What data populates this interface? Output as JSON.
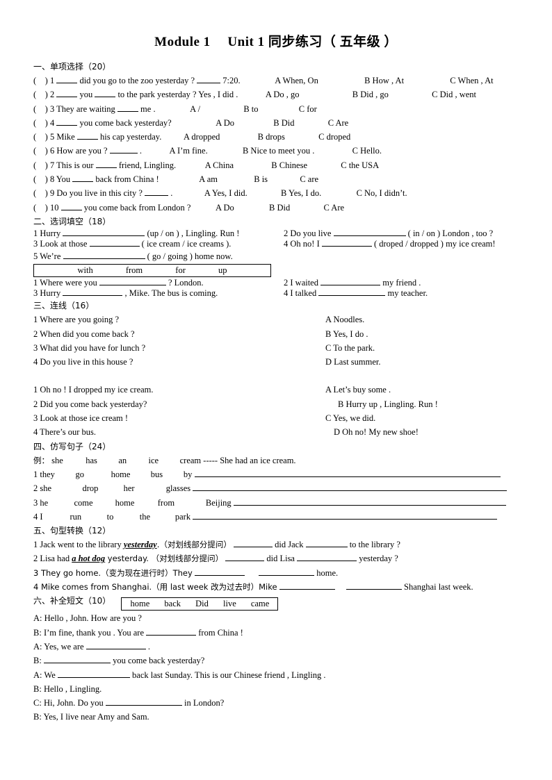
{
  "doc": {
    "title": "Module 1　 Unit 1 同步练习（ 五年级 ）"
  },
  "section1": {
    "heading": "一、单项选择（20）",
    "items": [
      {
        "num": "1",
        "stem_a": "did you go to the zoo yesterday ?",
        "stem_b": "7:20.",
        "a": "A When, On",
        "b": "B How , At",
        "c": "C When , At"
      },
      {
        "num": "2",
        "stem_a": "you",
        "stem_b": "to the park yesterday ? Yes , I did .",
        "a": "A Do , go",
        "b": "B Did , go",
        "c": "C Did , went"
      },
      {
        "num": "3",
        "stem_a": "They are waiting",
        "stem_b": "me .",
        "a": "A /",
        "b": "B to",
        "c": "C for"
      },
      {
        "num": "4",
        "stem_a": "",
        "stem_b": "you come back yesterday?",
        "a": "A Do",
        "b": "B Did",
        "c": "C Are"
      },
      {
        "num": "5",
        "stem_a": "Mike",
        "stem_b": "his cap yesterday.",
        "a": "A dropped",
        "b": "B drops",
        "c": "C droped"
      },
      {
        "num": "6",
        "stem_a": "How are you ?",
        "stem_b": ".",
        "a": "A I’m fine.",
        "b": "B Nice to meet you .",
        "c": "C Hello."
      },
      {
        "num": "7",
        "stem_a": "This is our",
        "stem_b": "friend, Lingling.",
        "a": "A China",
        "b": "B Chinese",
        "c": "C the USA"
      },
      {
        "num": "8",
        "stem_a": "You",
        "stem_b": "back from China !",
        "a": "A am",
        "b": "B is",
        "c": "C are"
      },
      {
        "num": "9",
        "stem_a": "Do you live in this city ?",
        "stem_b": ".",
        "a": "A Yes, I did.",
        "b": "B Yes, I do.",
        "c": "C No, I didn’t."
      },
      {
        "num": "10",
        "stem_a": "",
        "stem_b": "you come back from London ?",
        "a": "A Do",
        "b": "B Did",
        "c": "C Are"
      }
    ]
  },
  "section2": {
    "heading": "二、选词填空（18）",
    "q1_pre": "1 Hurry",
    "q1_post": "(up / on ) , Lingling. Run !",
    "q2_pre": "2 Do you live",
    "q2_post": "( in / on ) London , too ?",
    "q3_pre": "3 Look at those",
    "q3_post": "( ice cream / ice creams ).",
    "q4_pre": "4 Oh no! I",
    "q4_post": "( droped / dropped ) my ice cream!",
    "q5_pre": "5 We’re",
    "q5_post": "( go / going ) home now.",
    "wordbank": [
      "with",
      "from",
      "for",
      "up"
    ],
    "b1_pre": "1 Where were you",
    "b1_post": "? London.",
    "b2_pre": "2 I waited",
    "b2_post": "my friend .",
    "b3_pre": "3 Hurry",
    "b3_post": ", Mike. The bus is coming.",
    "b4_pre": "4 I talked",
    "b4_post": "my teacher."
  },
  "section3": {
    "heading": "三、连线（16）",
    "group1": {
      "questions": [
        "1 Where are you going ?",
        "2 When did you come back ?",
        "3 What did you have for lunch ?",
        "4 Do you live in this house ?"
      ],
      "answers": [
        "A Noodles.",
        "B Yes, I do .",
        "C To the park.",
        "D Last summer."
      ]
    },
    "group2": {
      "questions": [
        "1 Oh no ! I dropped my ice cream.",
        "2 Did you come back yesterday?",
        "3 Look at those ice cream !",
        "4 There’s our bus."
      ],
      "answers": [
        "A Let’s buy some .",
        "B Hurry up , Lingling. Run !",
        "C Yes, we did.",
        "D Oh no! My new shoe!"
      ]
    }
  },
  "section4": {
    "heading": "四、仿写句子（24）",
    "example_label": "例：",
    "example_words": [
      "she",
      "has",
      "an",
      "ice",
      "cream"
    ],
    "example_sep": "-----",
    "example_answer": "She had an ice cream.",
    "items": [
      {
        "num": "1",
        "words": [
          "they",
          "go",
          "home",
          "bus",
          "by"
        ]
      },
      {
        "num": "2",
        "words": [
          "she",
          "drop",
          "her",
          "glasses"
        ]
      },
      {
        "num": "3",
        "words": [
          "he",
          "come",
          "home",
          "from",
          "Beijing"
        ]
      },
      {
        "num": "4",
        "words": [
          "I",
          "run",
          "to",
          "the",
          "park"
        ]
      }
    ]
  },
  "section5": {
    "heading": "五、句型转换（12）",
    "q1_a": "1 Jack went to the library ",
    "q1_em": "yesterday",
    "q1_b": ".（对划线部分提问）",
    "q1_c": "did Jack",
    "q1_d": "to the library ?",
    "q2_a": "2 Lisa had ",
    "q2_em": "a hot dog",
    "q2_b": " yesterday. （对划线部分提问）",
    "q2_c": "did Lisa",
    "q2_d": "yesterday ?",
    "q3_a": "3 They go home.（变为现在进行时）They",
    "q3_b": "home.",
    "q4_a": "4 Mike comes from Shanghai.（用 last week 改为过去时）Mike",
    "q4_b": "Shanghai last week."
  },
  "section6": {
    "heading": "六、补全短文（10）",
    "wordbank": [
      "home",
      "back",
      "Did",
      "live",
      "came"
    ],
    "lines": [
      {
        "speaker": "A:",
        "pre": "Hello , John. How are you ?",
        "post": "",
        "blank": "none"
      },
      {
        "speaker": "B:",
        "pre": "I’m fine, thank you . You are",
        "post": "from China !",
        "blank": "u72"
      },
      {
        "speaker": "A:",
        "pre": "Yes, we are",
        "post": ".",
        "blank": "u86"
      },
      {
        "speaker": "B:",
        "pre": "",
        "post": "you come back yesterday?",
        "blank": "u96"
      },
      {
        "speaker": "A:",
        "pre": "We",
        "post": "back last Sunday. This is our Chinese friend , Lingling .",
        "blank": "u104"
      },
      {
        "speaker": "B:",
        "pre": "Hello , Lingling.",
        "post": "",
        "blank": "none"
      },
      {
        "speaker": "C:",
        "pre": "Hi, John. Do you",
        "post": "in London?",
        "blank": "u110"
      },
      {
        "speaker": "B:",
        "pre": "Yes, I live near Amy and Sam.",
        "post": "",
        "blank": "none"
      }
    ]
  }
}
